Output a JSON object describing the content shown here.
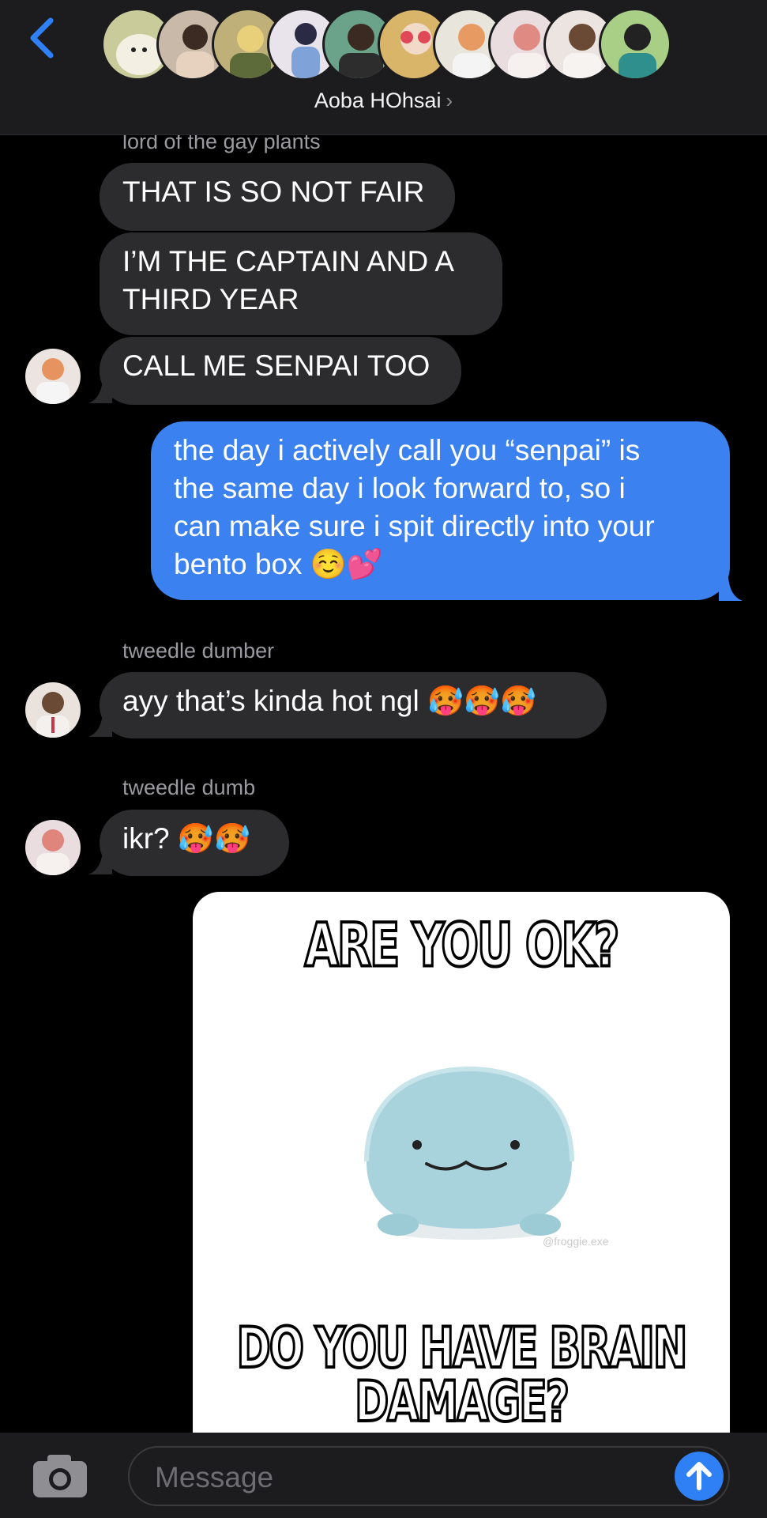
{
  "header": {
    "group_name": "Aoba HOhsai",
    "chevron": "›",
    "avatars": [
      "#c9cc9a",
      "#c9b9a8",
      "#bfb07a",
      "#e9e3ec",
      "#6aa38a",
      "#d9b56a",
      "#e8e6dc",
      "#eadde0",
      "#ece4e0",
      "#a9cf86"
    ]
  },
  "messages": {
    "sender_top": "lord of the gay plants",
    "m1": "THAT IS SO NOT FAIR",
    "m2": "I’M THE CAPTAIN AND A\nTHIRD YEAR",
    "m3": "CALL ME SENPAI TOO",
    "m4": "the day i actively call you “senpai” is\nthe same day i look forward to, so i\ncan make sure i spit directly into your\nbento box ☺️💕",
    "sender2": "tweedle dumber",
    "m5": "ayy that’s kinda hot ngl 🥵🥵🥵",
    "sender3": "tweedle dumb",
    "m6": "ikr? 🥵🥵"
  },
  "meme": {
    "top_text": "ARE YOU OK?",
    "bottom_text_1": "DO YOU HAVE BRAIN",
    "bottom_text_2": "DAMAGE?",
    "watermark": "@froggie.exe"
  },
  "composer": {
    "placeholder": "Message"
  },
  "colors": {
    "incoming": "#2c2c2e",
    "outgoing": "#3b82f0",
    "accent": "#2f80f5"
  }
}
